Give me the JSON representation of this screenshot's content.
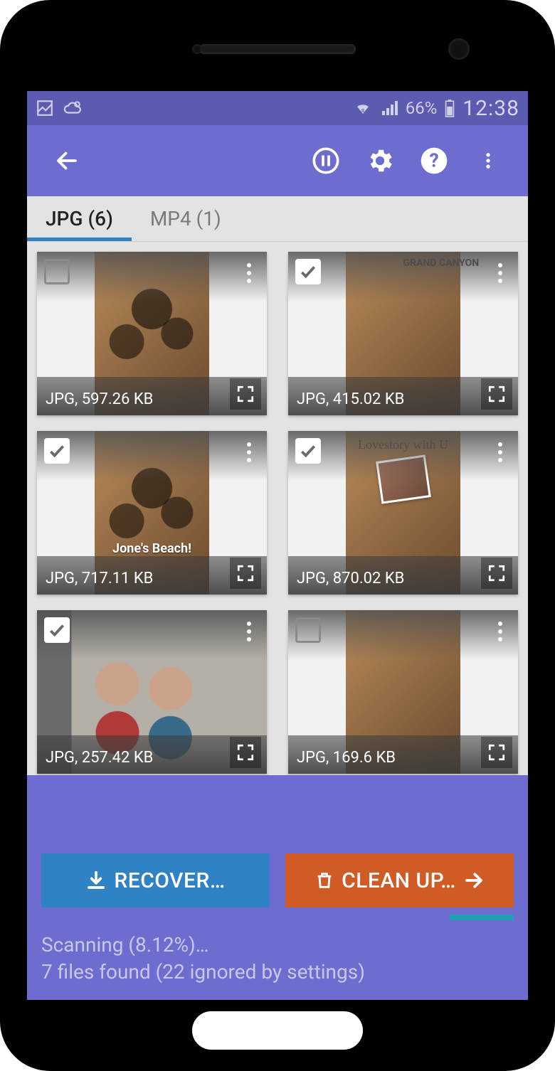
{
  "status_bar": {
    "battery_pct": "66%",
    "time": "12:38"
  },
  "tabs": [
    {
      "label": "JPG (6)",
      "active": true
    },
    {
      "label": "MP4 (1)",
      "active": false
    }
  ],
  "tiles": [
    {
      "size_label": "JPG, 597.26 KB",
      "checked": false,
      "variant": "beach",
      "overlay": ""
    },
    {
      "size_label": "JPG, 415.02 KB",
      "checked": true,
      "variant": "canyon",
      "overlay": "",
      "canyon_title": "GRAND CANYON"
    },
    {
      "size_label": "JPG, 717.11 KB",
      "checked": true,
      "variant": "beach",
      "overlay": "Jone's Beach!"
    },
    {
      "size_label": "JPG, 870.02 KB",
      "checked": true,
      "variant": "lovestory",
      "overlay": "",
      "ls_title": "Lovestory with U"
    },
    {
      "size_label": "JPG, 257.42 KB",
      "checked": true,
      "variant": "selfie",
      "overlay": ""
    },
    {
      "size_label": "JPG, 169.6 KB",
      "checked": false,
      "variant": "plain",
      "overlay": ""
    }
  ],
  "buttons": {
    "recover": "RECOVER…",
    "cleanup": "CLEAN UP…"
  },
  "footer": {
    "scanning": "Scanning (8.12%)…",
    "found": "7 files found (22 ignored by settings)"
  }
}
